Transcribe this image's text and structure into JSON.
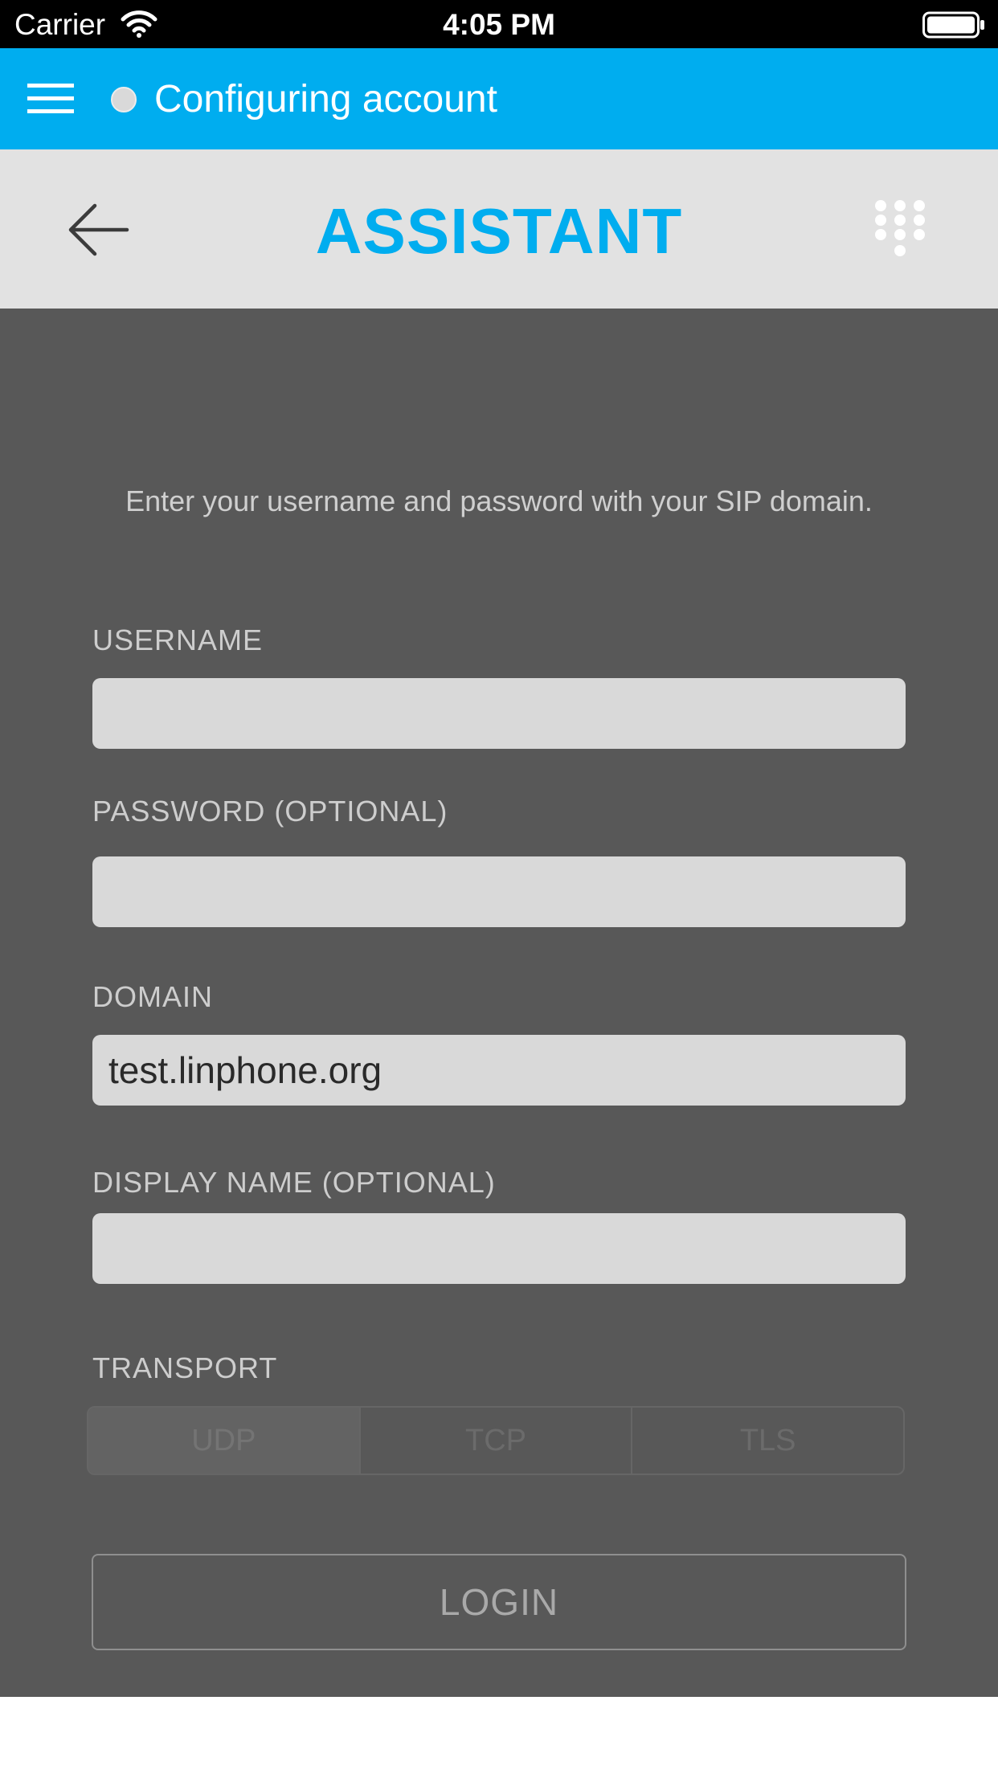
{
  "status_bar": {
    "carrier": "Carrier",
    "time": "4:05 PM",
    "wifi_icon": "wifi-icon",
    "battery_icon": "battery-icon"
  },
  "top_bar": {
    "menu_icon": "hamburger-menu-icon",
    "status_text": "Configuring account",
    "background_color": "#00adef"
  },
  "header": {
    "back_icon": "back-arrow-icon",
    "title": "ASSISTANT",
    "dialer_icon": "dialpad-icon",
    "title_color": "#00adef"
  },
  "form": {
    "instructions": "Enter your username and password with your SIP domain.",
    "username": {
      "label": "USERNAME",
      "value": ""
    },
    "password": {
      "label": "PASSWORD (OPTIONAL)",
      "value": ""
    },
    "domain": {
      "label": "DOMAIN",
      "value": "test.linphone.org"
    },
    "display_name": {
      "label": "DISPLAY NAME (OPTIONAL)",
      "value": ""
    },
    "transport": {
      "label": "TRANSPORT",
      "options": [
        "UDP",
        "TCP",
        "TLS"
      ],
      "selected": "UDP"
    },
    "login_label": "LOGIN"
  }
}
